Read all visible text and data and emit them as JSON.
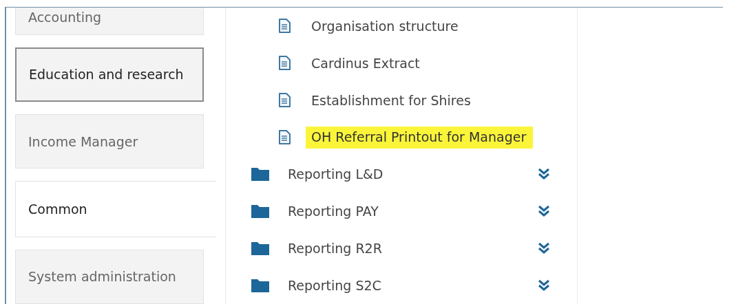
{
  "tabs": [
    {
      "label": "Accounting",
      "selected": false,
      "outlined": false
    },
    {
      "label": "Education and research",
      "selected": false,
      "outlined": true
    },
    {
      "label": "Income Manager",
      "selected": false,
      "outlined": false
    },
    {
      "label": "Common",
      "selected": true,
      "outlined": false
    },
    {
      "label": "System administration",
      "selected": false,
      "outlined": false
    }
  ],
  "tree": [
    {
      "kind": "document",
      "label": "Organisation structure",
      "highlighted": false
    },
    {
      "kind": "document",
      "label": "Cardinus Extract",
      "highlighted": false
    },
    {
      "kind": "document",
      "label": "Establishment for Shires",
      "highlighted": false
    },
    {
      "kind": "document",
      "label": "OH Referral Printout for Manager",
      "highlighted": true
    },
    {
      "kind": "folder",
      "label": "Reporting L&D",
      "expanded": false
    },
    {
      "kind": "folder",
      "label": "Reporting PAY",
      "expanded": false
    },
    {
      "kind": "folder",
      "label": "Reporting R2R",
      "expanded": false
    },
    {
      "kind": "folder",
      "label": "Reporting S2C",
      "expanded": false
    }
  ]
}
